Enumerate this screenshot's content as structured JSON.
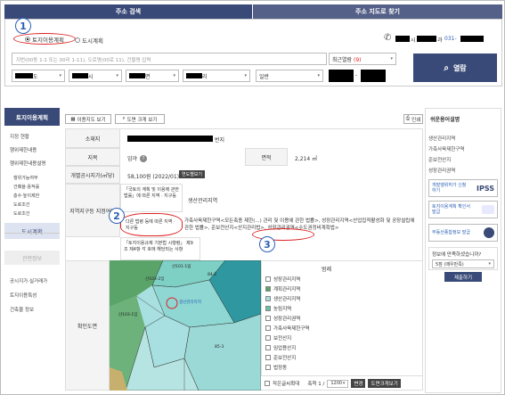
{
  "tabs": {
    "search": "주소 검색",
    "map": "주소 지도로 찾기"
  },
  "radios": {
    "land": "토지이용계획",
    "city": "도시계획"
  },
  "contact": {
    "prefix": "시",
    "mid": "과",
    "suffix": "031-"
  },
  "search": {
    "placeholder": "지번(00동 1-1 또는 00리 1-11), 도로명(00로 11), 건물명 입력",
    "recent": "최근열람",
    "recent_count": "(9)",
    "button": "열람"
  },
  "selects": {
    "province": "도",
    "city": "시",
    "district": "면",
    "village": "리",
    "type": "일반"
  },
  "sidebar": {
    "title": "토지이용계획",
    "items": [
      "지정 현황",
      "행위제한내용",
      "행위제한내용설명"
    ],
    "subitems": [
      "행위가능여부",
      "건폐율·용적률",
      "층수·높이제한",
      "도로조건",
      "도로조건"
    ],
    "active": "도시계획",
    "gray": "관련정보",
    "lower": [
      "공시지가·실거래가",
      "토지이용특성",
      "건축물 정보"
    ]
  },
  "toolbar": {
    "map_view": "이용지도 보기",
    "map_large": "도면 크게 보기",
    "print": "인쇄"
  },
  "table": {
    "location_label": "소재지",
    "location_suffix": "번지",
    "category_label": "지목",
    "category_value": "임야",
    "area_label": "면적",
    "area_value": "2,214 ㎡",
    "price_label": "개별공시지가(㎡당)",
    "price_value": "58,100원 (2022/01)",
    "price_btn": "연도별보기",
    "zone_label": "지역지구등 지정여부",
    "law1_label": "「국토의 계획 및 이용에 관한 법률」에 따른 지역 · 지구등",
    "law1_value": "생산관리지역",
    "law2_label": "다른 법령 등에 따른 지역 · 지구등",
    "law2_value": "가축사육제한구역<모든축종 제한(...) 관리 및 이용에 관한 법률>, 성장관리지역<산업집적활성화 및 공장설립에 관한 법률>, 준보전산지<산지관리법>, 성장관리권역<수도권정비계획법>",
    "law3_label": "「토지이용규제 기본법 시행령」 제9조 제4항 각 호에 해당되는 사항",
    "map_label": "확인도면"
  },
  "legend": {
    "title": "범례",
    "items": [
      "성장관리지역",
      "계획관리지역",
      "생산관리지역",
      "농림지역",
      "성장관리권역",
      "가축사육제한구역",
      "보전산지",
      "임업용산지",
      "준보전산지",
      "법정동"
    ],
    "colors": [
      "#ffffff",
      "#5aa469",
      "#a8dfe0",
      "#69c2a3",
      "#ffffff",
      "#ffffff",
      "#ffffff",
      "#ffffff",
      "#ffffff",
      "#ffffff"
    ]
  },
  "mapfoot": {
    "small": "작은글씨확대",
    "scale": "축척 1 /",
    "scale_val": "1200",
    "change": "변경",
    "large": "도면크게보기"
  },
  "map_labels": [
    "산101-1림",
    "산103-2임",
    "산103-1임",
    "생산관리지역",
    "84-2",
    "85-3"
  ],
  "right": {
    "title": "쉬운용어설명",
    "links": [
      "생산관리지역",
      "가축사육제한구역",
      "준보전산지",
      "성장관리권역"
    ],
    "banners": [
      "개발행위허가 신청하기",
      "토지이용계획 확인서 발급",
      "부동산종합정보 발급"
    ],
    "ipss": "IPSS",
    "survey_q": "정보에 만족하셨습니까?",
    "survey_opt": "5점 (매우만족)",
    "survey_btn": "제출하기"
  },
  "markers": [
    "1",
    "2",
    "3"
  ]
}
